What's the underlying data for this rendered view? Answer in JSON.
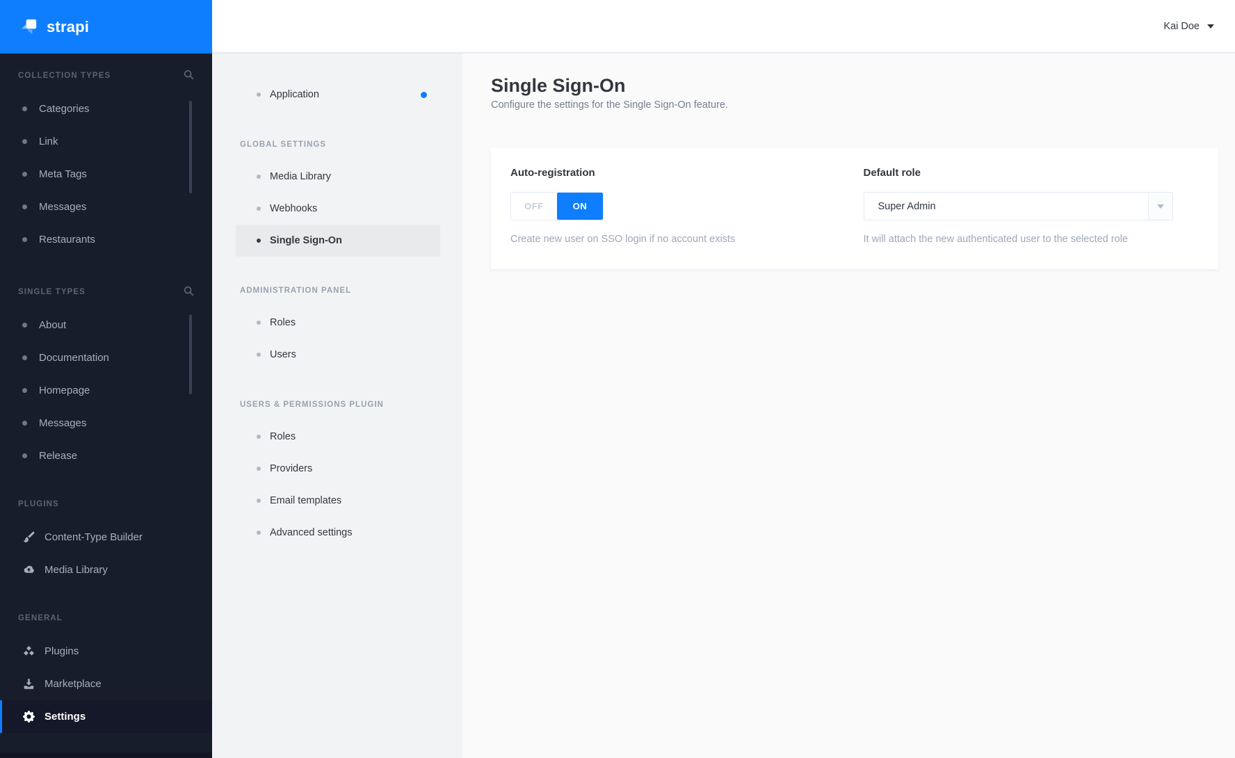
{
  "brand": {
    "name": "strapi"
  },
  "colors": {
    "primary": "#0e7eff",
    "sidebar_bg": "#181d2c",
    "submenu_bg": "#f2f3f4",
    "main_bg": "#fafafb"
  },
  "topbar": {
    "user_name": "Kai Doe"
  },
  "sidebar": {
    "sections": [
      {
        "label": "COLLECTION TYPES",
        "has_search": true,
        "items": [
          {
            "label": "Categories"
          },
          {
            "label": "Link"
          },
          {
            "label": "Meta Tags"
          },
          {
            "label": "Messages"
          },
          {
            "label": "Restaurants"
          }
        ]
      },
      {
        "label": "SINGLE TYPES",
        "has_search": true,
        "items": [
          {
            "label": "About"
          },
          {
            "label": "Documentation"
          },
          {
            "label": "Homepage"
          },
          {
            "label": "Messages"
          },
          {
            "label": "Release"
          }
        ]
      },
      {
        "label": "PLUGINS",
        "items": [
          {
            "label": "Content-Type Builder",
            "icon": "paintbrush-icon"
          },
          {
            "label": "Media Library",
            "icon": "cloud-upload-icon"
          }
        ]
      },
      {
        "label": "GENERAL",
        "items": [
          {
            "label": "Plugins",
            "icon": "cubes-icon"
          },
          {
            "label": "Marketplace",
            "icon": "download-icon"
          },
          {
            "label": "Settings",
            "icon": "gear-icon",
            "active": true
          }
        ]
      }
    ]
  },
  "settings_menu": {
    "items_top": [
      {
        "label": "Application",
        "has_notification": true
      }
    ],
    "sections": [
      {
        "label": "GLOBAL SETTINGS",
        "items": [
          {
            "label": "Media Library"
          },
          {
            "label": "Webhooks"
          },
          {
            "label": "Single Sign-On",
            "active": true
          }
        ]
      },
      {
        "label": "ADMINISTRATION PANEL",
        "items": [
          {
            "label": "Roles"
          },
          {
            "label": "Users"
          }
        ]
      },
      {
        "label": "USERS & PERMISSIONS PLUGIN",
        "items": [
          {
            "label": "Roles"
          },
          {
            "label": "Providers"
          },
          {
            "label": "Email templates"
          },
          {
            "label": "Advanced settings"
          }
        ]
      }
    ]
  },
  "main": {
    "title": "Single Sign-On",
    "subtitle": "Configure the settings for the Single Sign-On feature.",
    "card": {
      "auto_registration": {
        "label": "Auto-registration",
        "options": [
          "OFF",
          "ON"
        ],
        "value": "ON",
        "helper": "Create new user on SSO login if no account exists"
      },
      "default_role": {
        "label": "Default role",
        "value": "Super Admin",
        "helper": "It will attach the new authenticated user to the selected role"
      }
    }
  }
}
